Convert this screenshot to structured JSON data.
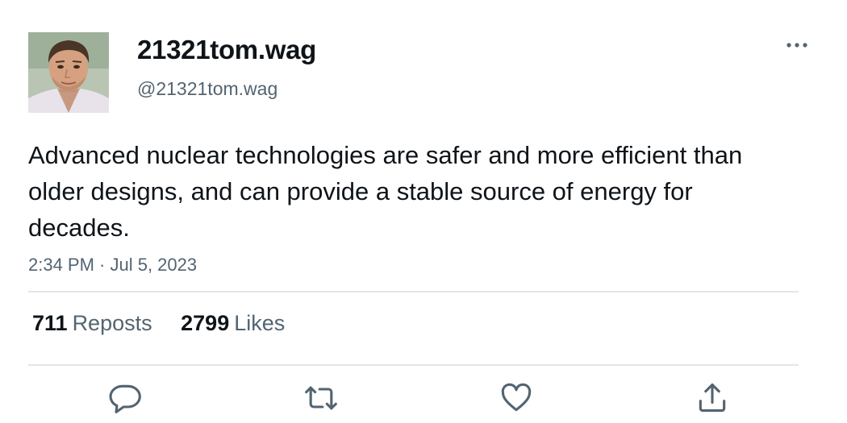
{
  "user": {
    "display_name": "21321tom.wag",
    "handle": "@21321tom.wag"
  },
  "tweet": {
    "text": "Advanced nuclear technologies are safer and more efficient than older designs, and can provide a stable source of energy for decades.",
    "timestamp": "2:34 PM · Jul 5, 2023"
  },
  "stats": {
    "reposts_count": "711",
    "reposts_label": "Reposts",
    "likes_count": "2799",
    "likes_label": "Likes"
  },
  "icons": {
    "more": "more-horizontal-icon",
    "reply": "reply-icon",
    "repost": "repost-icon",
    "like": "heart-icon",
    "share": "share-icon"
  },
  "colors": {
    "text": "#0f1419",
    "secondary": "#536471",
    "divider": "#e3e6e8"
  }
}
